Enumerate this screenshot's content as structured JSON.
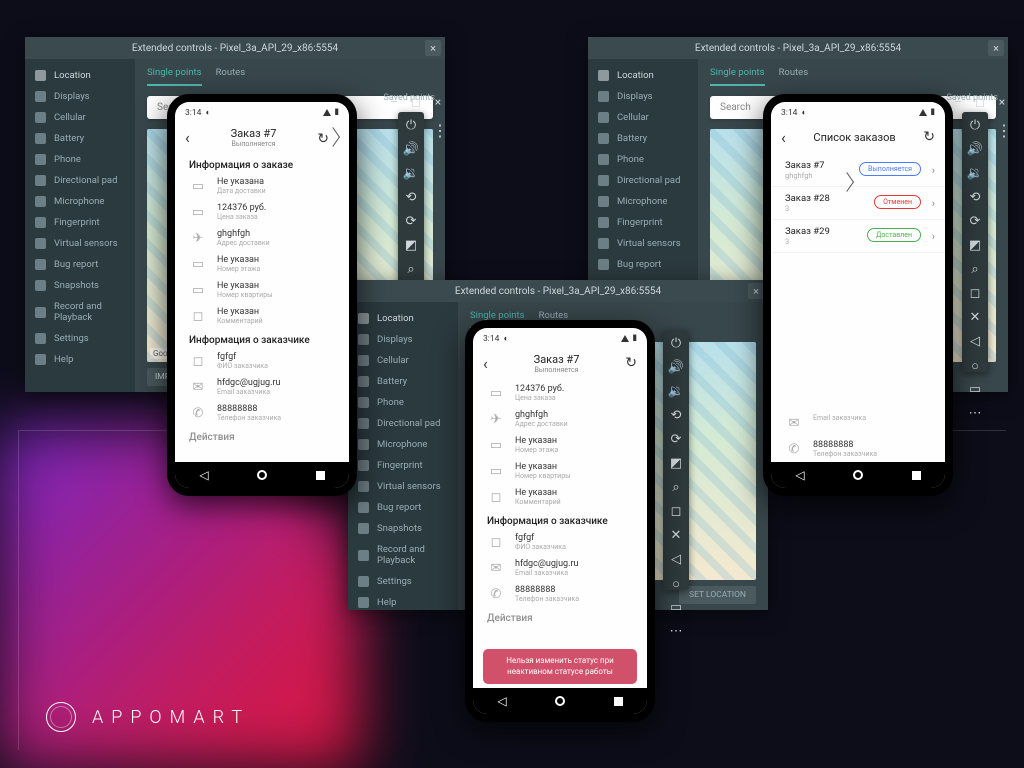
{
  "logo_text": "APPOMART",
  "emu": {
    "title": "Extended controls - Pixel_3a_API_29_x86:5554",
    "sidebar": [
      "Location",
      "Displays",
      "Cellular",
      "Battery",
      "Phone",
      "Directional pad",
      "Microphone",
      "Fingerprint",
      "Virtual sensors",
      "Bug report",
      "Snapshots",
      "Record and Playback",
      "Settings",
      "Help"
    ],
    "tabs": {
      "single": "Single points",
      "routes": "Routes"
    },
    "search_placeholder": "Search",
    "saved_points": "Saved points",
    "import": "IMPORT",
    "setloc": "SET LOCATION",
    "map_attrib": "Google"
  },
  "phoneA": {
    "time": "3:14",
    "title": "Заказ #7",
    "subtitle": "Выполняется",
    "section1": "Информация о заказе",
    "rows1": [
      {
        "v": "Не указана",
        "l": "Дата доставки"
      },
      {
        "v": "124376 руб.",
        "l": "Цена заказа"
      },
      {
        "v": "ghghfgh",
        "l": "Адрес доставки"
      },
      {
        "v": "Не указан",
        "l": "Номер этажа"
      },
      {
        "v": "Не указан",
        "l": "Номер квартиры"
      },
      {
        "v": "Не указан",
        "l": "Комментарий"
      }
    ],
    "section2": "Информация о заказчике",
    "rows2": [
      {
        "v": "fgfgf",
        "l": "ФИО заказчика"
      },
      {
        "v": "hfdgc@ugjug.ru",
        "l": "Email заказчика"
      },
      {
        "v": "88888888",
        "l": "Телефон заказчика"
      }
    ],
    "section3": "Действия"
  },
  "phoneB": {
    "time": "3:14",
    "title": "Заказ #7",
    "subtitle": "Выполняется",
    "rows1": [
      {
        "v": "124376 руб.",
        "l": "Цена заказа"
      },
      {
        "v": "ghghfgh",
        "l": "Адрес доставки"
      },
      {
        "v": "Не указан",
        "l": "Номер этажа"
      },
      {
        "v": "Не указан",
        "l": "Номер квартиры"
      },
      {
        "v": "Не указан",
        "l": "Комментарий"
      }
    ],
    "section2": "Информация о заказчике",
    "rows2": [
      {
        "v": "fgfgf",
        "l": "ФИО заказчика"
      },
      {
        "v": "hfdgc@ugjug.ru",
        "l": "Email заказчика"
      },
      {
        "v": "88888888",
        "l": "Телефон заказчика"
      }
    ],
    "section3": "Действия",
    "snackbar": "Нельзя изменить статус при неактивном статусе работы"
  },
  "phoneC": {
    "time": "3:14",
    "title": "Список заказов",
    "orders": [
      {
        "name": "Заказ #7",
        "sub": "ghghfgh",
        "badge": "Выполняется",
        "cls": "blue"
      },
      {
        "name": "Заказ #28",
        "sub": "3",
        "badge": "Отменен",
        "cls": "red"
      },
      {
        "name": "Заказ #29",
        "sub": "3",
        "badge": "Доставлен",
        "cls": "green"
      }
    ],
    "tailrows": [
      {
        "v": "",
        "l": "Email заказчика"
      },
      {
        "v": "88888888",
        "l": "Телефон заказчика"
      }
    ]
  }
}
